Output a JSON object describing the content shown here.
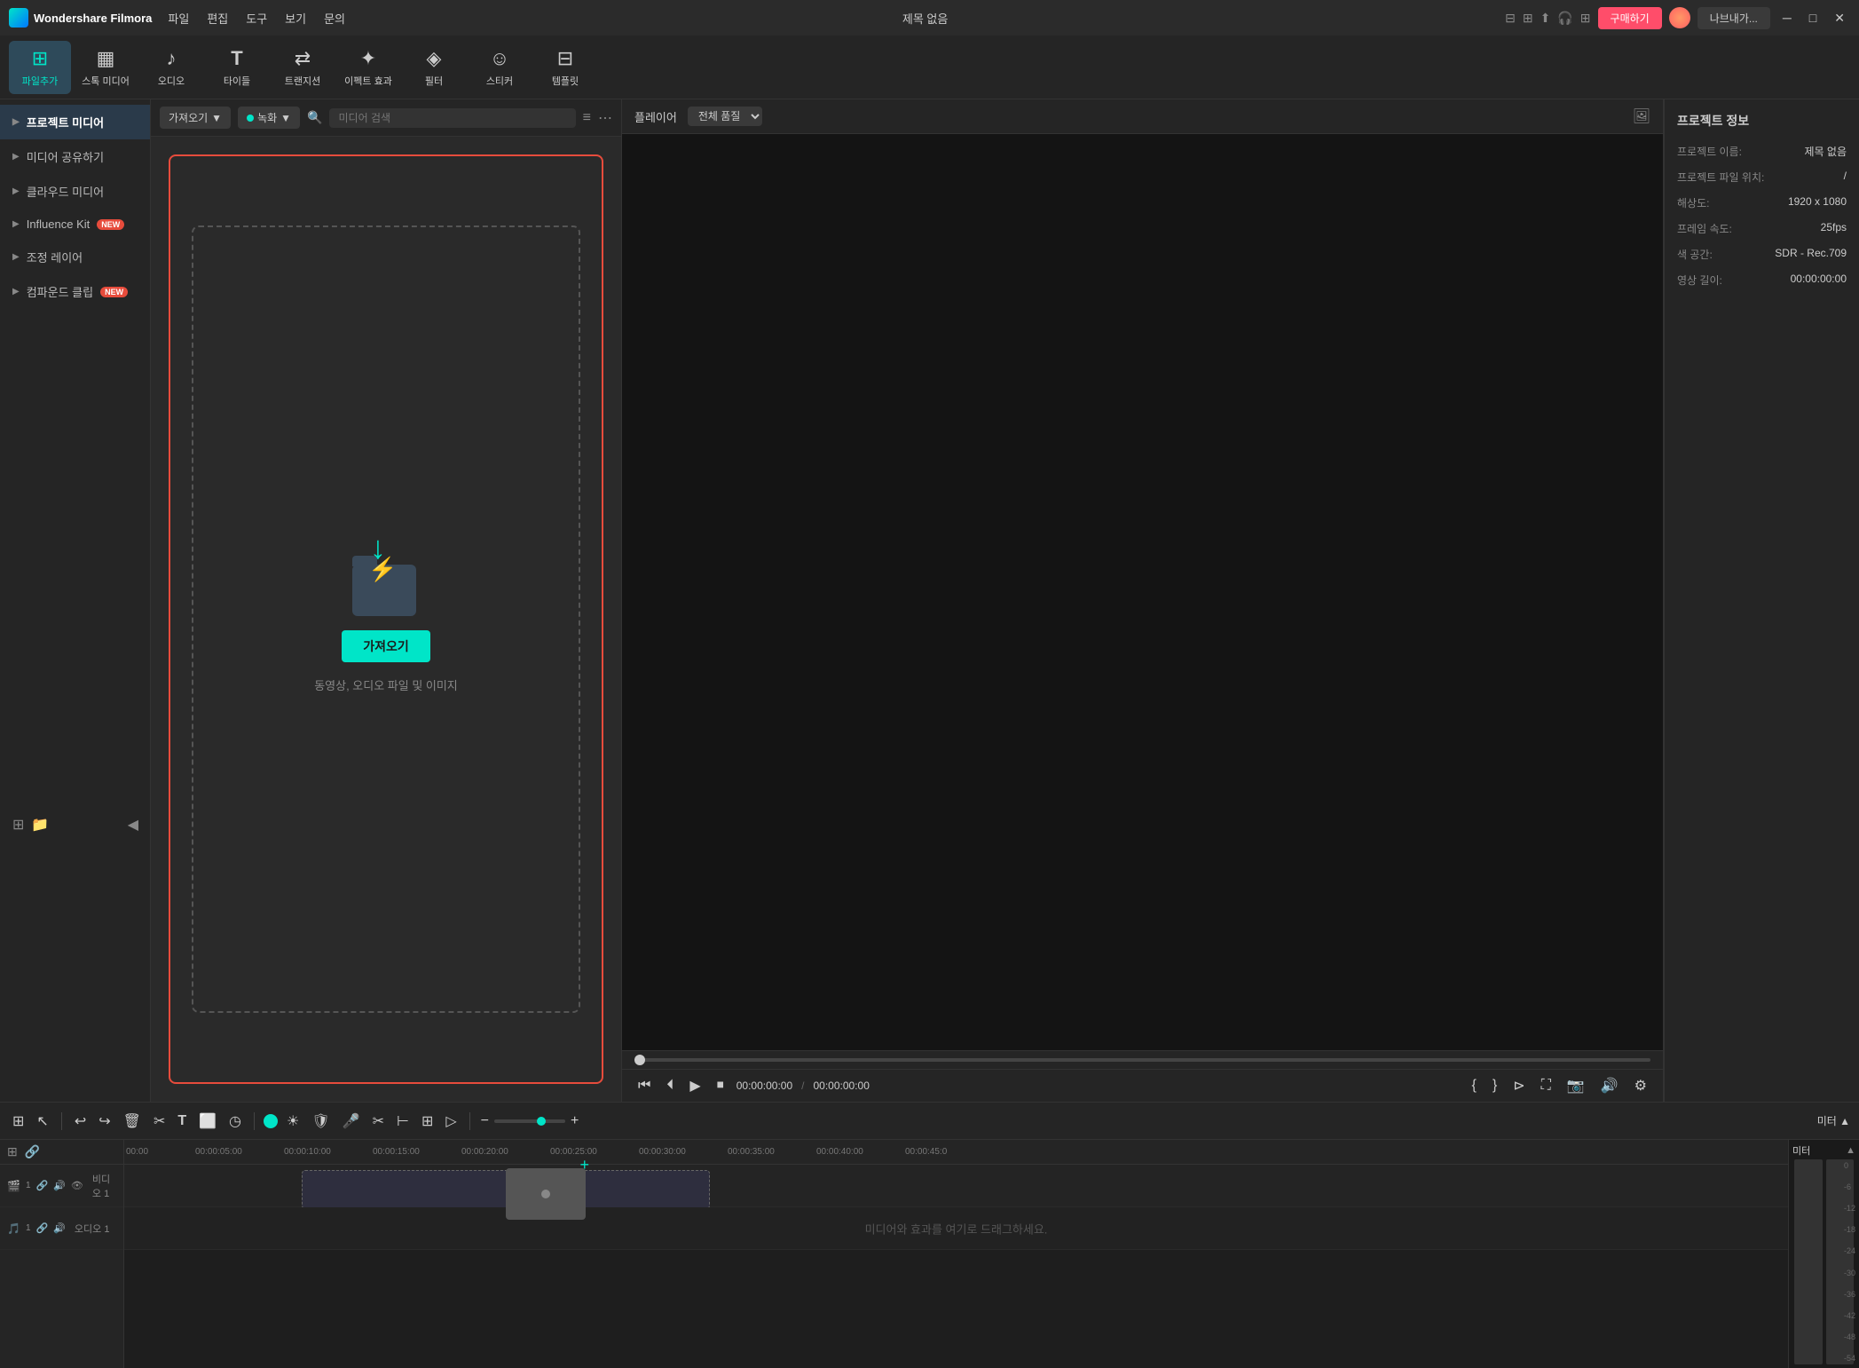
{
  "app": {
    "name": "Wondershare Filmora",
    "title": "제목 없음",
    "logo_text": "Wondershare Filmora"
  },
  "titlebar": {
    "menu": [
      "파일",
      "편집",
      "도구",
      "보기",
      "문의"
    ],
    "title": "제목 없음",
    "btn_purchase": "구매하기",
    "btn_login": "나브내가..."
  },
  "toolbar": {
    "items": [
      {
        "id": "file-add",
        "icon": "⊞",
        "label": "파일추가"
      },
      {
        "id": "stock-media",
        "icon": "▦",
        "label": "스톡 미디어"
      },
      {
        "id": "audio",
        "icon": "♪",
        "label": "오디오"
      },
      {
        "id": "titles",
        "icon": "T",
        "label": "타이들"
      },
      {
        "id": "transitions",
        "icon": "⇄",
        "label": "트랜지션"
      },
      {
        "id": "effects",
        "icon": "✦",
        "label": "이펙트 효과"
      },
      {
        "id": "filters",
        "icon": "◈",
        "label": "필터"
      },
      {
        "id": "stickers",
        "icon": "☺",
        "label": "스티커"
      },
      {
        "id": "templates",
        "icon": "⊟",
        "label": "템플릿"
      }
    ]
  },
  "sidebar": {
    "items": [
      {
        "id": "project-media",
        "label": "프로젝트 미디어",
        "active": true
      },
      {
        "id": "media-share",
        "label": "미디어 공유하기"
      },
      {
        "id": "cloud-media",
        "label": "클라우드 미디어"
      },
      {
        "id": "influence-kit",
        "label": "Influence Kit",
        "badge": "NEW"
      },
      {
        "id": "adjustment-layer",
        "label": "조정 레이어"
      },
      {
        "id": "compound-clip",
        "label": "컴파운드 클립",
        "badge": "NEW"
      }
    ],
    "actions": {
      "new_folder": "new-folder",
      "open_folder": "open-folder",
      "collapse": "collapse"
    }
  },
  "media_panel": {
    "import_btn": "가져오기",
    "record_btn": "녹화",
    "search_placeholder": "미디어 검색"
  },
  "drop_area": {
    "import_btn": "가져오기",
    "hint": "동영상, 오디오 파일 및 이미지"
  },
  "preview": {
    "title": "플레이어",
    "quality": "전체 품질",
    "time_current": "00:00:00:00",
    "time_separator": "/",
    "time_total": "00:00:00:00"
  },
  "project_info": {
    "title": "프로젝트 정보",
    "fields": [
      {
        "label": "프로젝트 이름:",
        "value": "제목 없음"
      },
      {
        "label": "프로젝트 파일 위치:",
        "value": "/"
      },
      {
        "label": "해상도:",
        "value": "1920 x 1080"
      },
      {
        "label": "프레임 속도:",
        "value": "25fps"
      },
      {
        "label": "색 공간:",
        "value": "SDR - Rec.709"
      },
      {
        "label": "영상 길이:",
        "value": "00:00:00:00"
      }
    ]
  },
  "timeline": {
    "rulers": [
      "00:00",
      "00:00:05:00",
      "00:00:10:00",
      "00:00:15:00",
      "00:00:20:00",
      "00:00:25:00",
      "00:00:30:00",
      "00:00:35:00",
      "00:00:40:00",
      "00:00:45:0"
    ],
    "tracks": [
      {
        "id": "video1",
        "type": "video",
        "label": "비디오 1",
        "icon": "🎬"
      },
      {
        "id": "audio1",
        "type": "audio",
        "label": "오디오 1",
        "icon": "🎵"
      }
    ],
    "drop_hint": "미디어와 효과를 여기로 드래그하세요.",
    "meter_title": "미터",
    "meter_values": [
      "0",
      "-6",
      "-12",
      "-18",
      "-24",
      "-30",
      "-36",
      "-42",
      "-48",
      "-54"
    ]
  }
}
